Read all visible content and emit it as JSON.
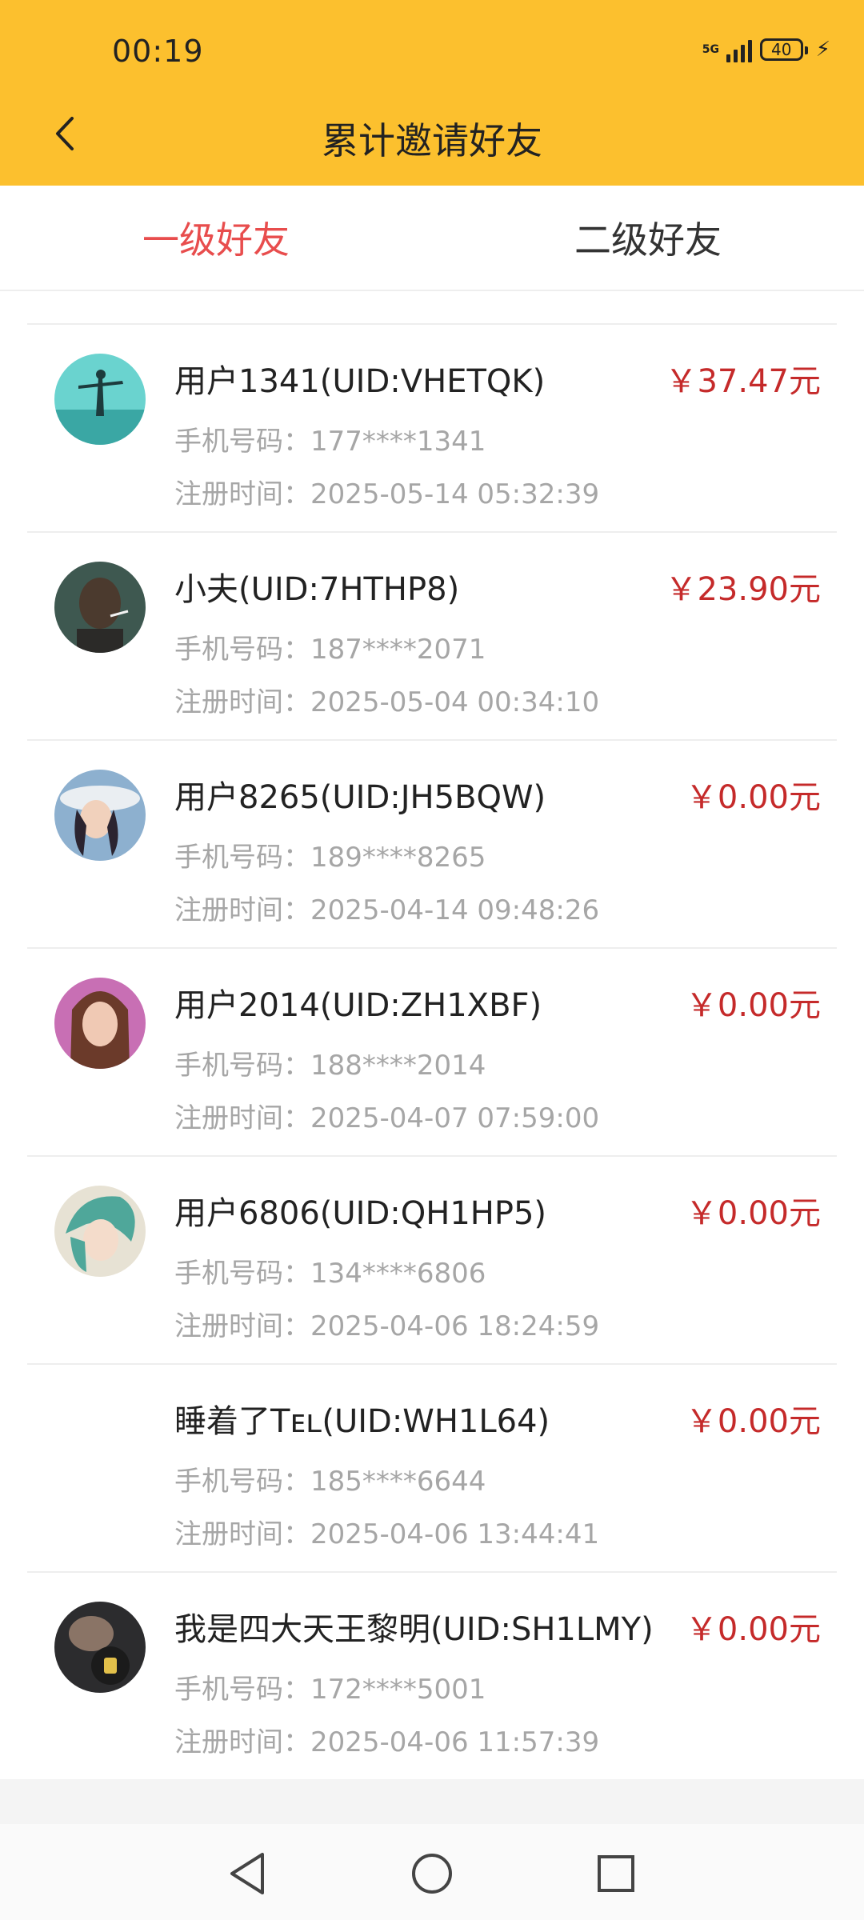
{
  "status": {
    "time": "00:19",
    "network": "5G",
    "battery": "40"
  },
  "header": {
    "title": "累计邀请好友"
  },
  "tabs": [
    {
      "label": "一级好友",
      "active": true
    },
    {
      "label": "二级好友",
      "active": false
    }
  ],
  "friends": [
    {
      "name": "用户1341(UID:VHETQK)",
      "amount": "￥37.47元",
      "phone": "手机号码：177****1341",
      "reg": "注册时间：2025-05-14 05:32:39"
    },
    {
      "name": "小夫(UID:7HTHP8)",
      "amount": "￥23.90元",
      "phone": "手机号码：187****2071",
      "reg": "注册时间：2025-05-04 00:34:10"
    },
    {
      "name": "用户8265(UID:JH5BQW)",
      "amount": "￥0.00元",
      "phone": "手机号码：189****8265",
      "reg": "注册时间：2025-04-14 09:48:26"
    },
    {
      "name": "用户2014(UID:ZH1XBF)",
      "amount": "￥0.00元",
      "phone": "手机号码：188****2014",
      "reg": "注册时间：2025-04-07 07:59:00"
    },
    {
      "name": "用户6806(UID:QH1HP5)",
      "amount": "￥0.00元",
      "phone": "手机号码：134****6806",
      "reg": "注册时间：2025-04-06 18:24:59"
    },
    {
      "name": "睡着了Tᴇʟ(UID:WH1L64)",
      "amount": "￥0.00元",
      "phone": "手机号码：185****6644",
      "reg": "注册时间：2025-04-06 13:44:41"
    },
    {
      "name": "我是四大天王黎明(UID:SH1LMY)",
      "amount": "￥0.00元",
      "phone": "手机号码：172****5001",
      "reg": "注册时间：2025-04-06 11:57:39"
    }
  ],
  "colors": {
    "header": "#fcc02e",
    "tab_active": "#e84d4d",
    "amount": "#c52a2a"
  },
  "icons": [
    "back-chevron-icon",
    "signal-icon",
    "battery-icon",
    "charging-icon",
    "nav-back-icon",
    "nav-home-icon",
    "nav-recents-icon"
  ]
}
